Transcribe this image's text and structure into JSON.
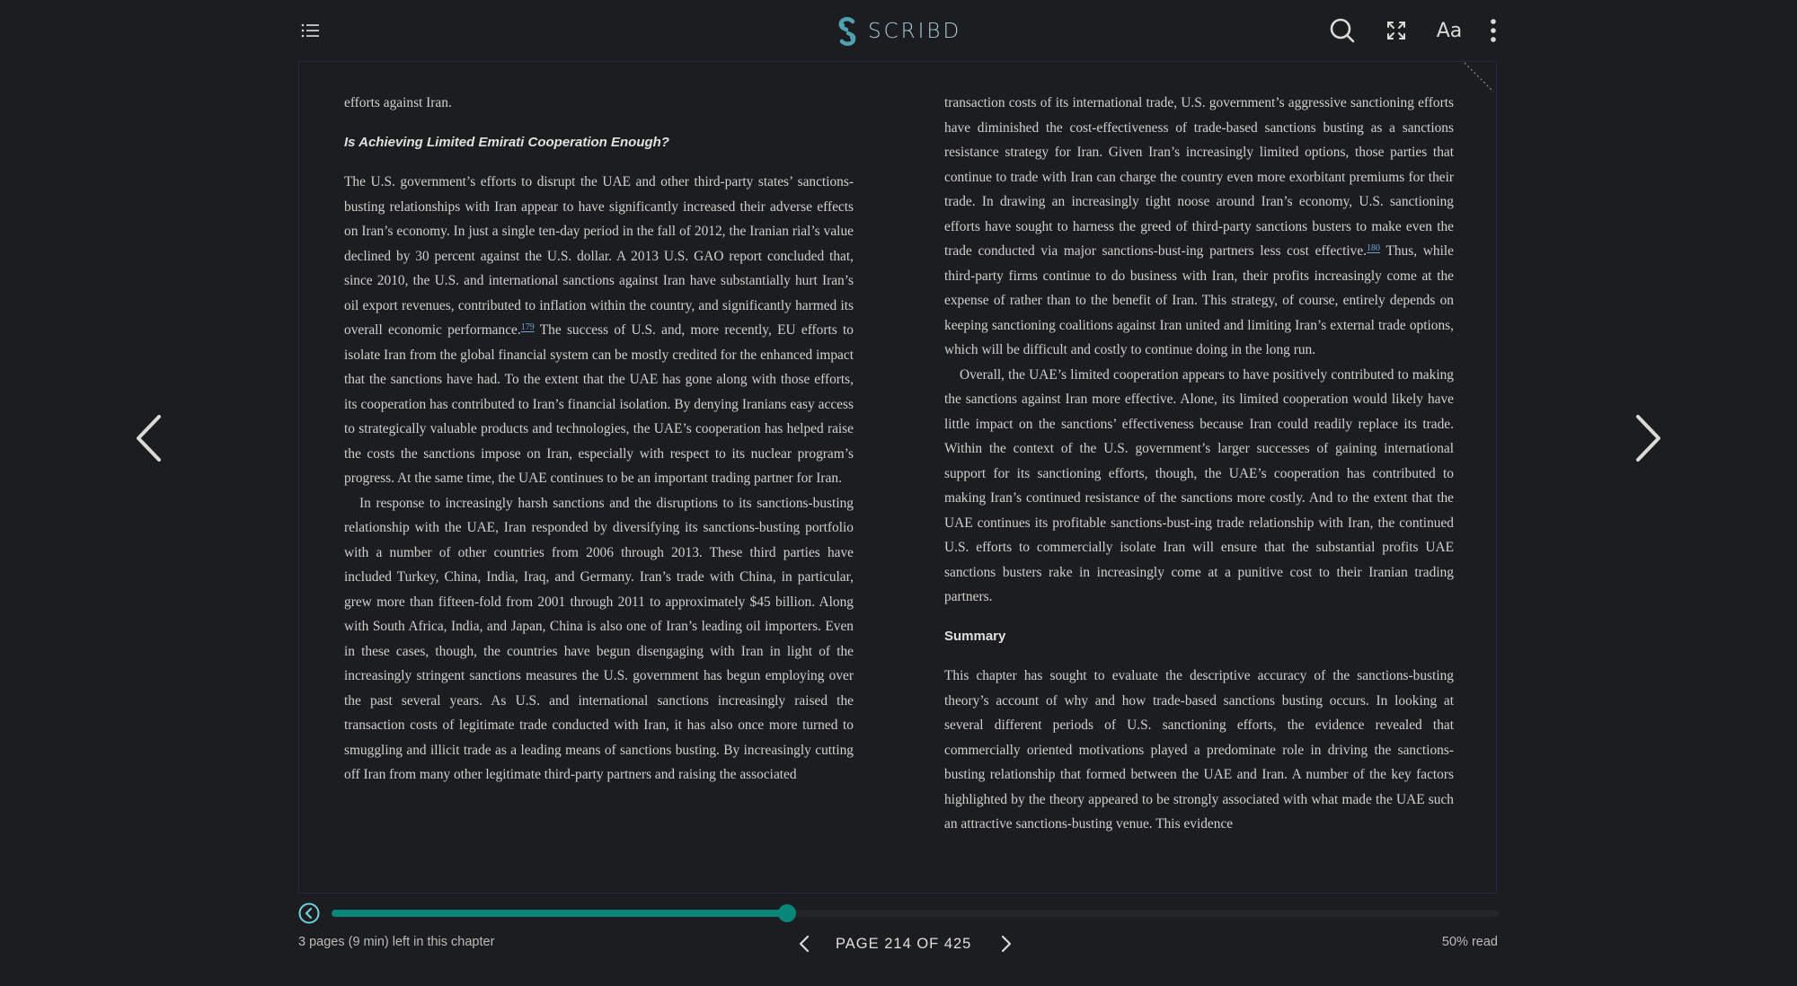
{
  "app": {
    "brand": "SCRIBD",
    "brand_color": "#4fa3b0",
    "accent_color": "#07877a"
  },
  "toolbar": {
    "toc_icon": "list-icon",
    "actions": [
      {
        "name": "search",
        "icon": "search-icon"
      },
      {
        "name": "fullscreen",
        "icon": "fullscreen-icon"
      },
      {
        "name": "font-settings",
        "label": "Aa"
      },
      {
        "name": "more",
        "icon": "more-vertical-icon"
      }
    ]
  },
  "page": {
    "left_column": {
      "p0": "efforts against Iran.",
      "heading": "Is Achieving Limited Emirati Cooperation Enough?",
      "p1_before_fn": "The U.S. government’s efforts to disrupt the UAE and other third-party states’ sanctions-busting relationships with Iran appear to have significantly increased their adverse effects on Iran’s economy. In just a single ten-day period in the fall of 2012, the Iranian rial’s value declined by 30 percent against the U.S. dollar. A 2013 U.S. GAO report concluded that, since 2010, the U.S. and international sanctions against Iran have substantially hurt Iran’s oil export revenues, contributed to infla­tion within the country, and significantly harmed its overall economic performance.",
      "fn1": "179",
      "p1_after_fn": " The success of U.S. and, more recently, EU efforts to isolate Iran from the global financial system can be mostly credited for the enhanced impact that the sanctions have had. To the extent that the UAE has gone along with those efforts, its cooperation has contributed to Iran’s financial isolation. By denying Ira­nians easy access to strategically valuable products and technologies, the UAE’s cooperation has helped raise the costs the sanctions impose on Iran, especially with respect to its nuclear program’s progress. At the same time, the UAE con­tinues to be an important trading partner for Iran.",
      "p2": "In response to increasingly harsh sanctions and the disruptions to its sanctions-busting relationship with the UAE, Iran responded by diversifying its sanctions-busting portfolio with a number of other countries from 2006 through 2013. These third parties have included Turkey, China, India, Iraq, and Germany. Iran’s trade with China, in particular, grew more than fifteen-fold from 2001 through 2011 to ap­proximately $45 billion. Along with South Africa, India, and Japan, China is also one of Iran’s leading oil importers. Even in these cases, though, the countries have begun disengaging with Iran in light of the increasingly stringent sanctions mea­sures the U.S. government has begun employing over the past several years. As U.S. and international sanctions increasingly raised the transaction costs of legit­imate trade conducted with Iran, it has also once more turned to smuggling and il­licit trade as a leading means of sanctions busting. By increasingly cutting off Iran from many other legitimate third-party partners and raising the associated"
    },
    "right_column": {
      "p1_before_fn": "transaction costs of its international trade, U.S. government’s aggressive sanc­tioning efforts have diminished the cost-effectiveness of trade-based sanctions busting as a sanctions resistance strategy for Iran. Given Iran’s increasingly limited options, those parties that continue to trade with Iran can charge the country even more exorbitant premiums for their trade. In drawing an increasingly tight noose around Iran’s economy, U.S. sanctioning efforts have sought to harness the greed of third-party sanctions busters to make even the trade conducted via major sanc­tions-bust-ing partners less cost effective.",
      "fn1": "180",
      "p1_after_fn": " Thus, while third-party firms continue to do business with Iran, their profits increasingly come at the expense of rather than to the benefit of Iran. This strategy, of course, entirely depends on keeping sanctioning coalitions against Iran united and limiting Iran’s external trade options, which will be difficult and costly to continue doing in the long run.",
      "p2": "Overall, the UAE’s limited cooperation appears to have positively contributed to making the sanctions against Iran more effective. Alone, its limited cooperation would likely have little impact on the sanctions’ effectiveness because Iran could readily replace its trade. Within the context of the U.S. government’s larger suc­cesses of gaining international support for its sanctioning efforts, though, the UAE’s cooperation has contributed to making Iran’s continued resistance of the sanctions more costly. And to the extent that the UAE continues its profitable sanc­tions-bust-ing trade relationship with Iran, the continued U.S. efforts to commer­cially isolate Iran will ensure that the substantial profits UAE sanctions busters rake in increasingly come at a punitive cost to their Iranian trading partners.",
      "heading": "Summary",
      "p3": "This chapter has sought to evaluate the descriptive accuracy of the sanctions-busting theory’s account of why and how trade-based sanctions busting occurs. In looking at several different periods of U.S. sanctioning efforts, the evidence re­vealed that commercially oriented motivations played a predominate role in driving the sanctions-busting relationship that formed between the UAE and Iran. A num­ber of the key factors highlighted by the theory appeared to be strongly associated with what made the UAE such an attractive sanctions-busting venue. This evidence"
    }
  },
  "navigation": {
    "prev_icon": "chevron-left-icon",
    "next_icon": "chevron-right-icon"
  },
  "footer": {
    "chapter_remaining": "3 pages (9 min) left in this chapter",
    "page_label": "PAGE 214 OF 425",
    "current_page": 214,
    "total_pages": 425,
    "percent_read_label": "50% read",
    "progress_fraction": 0.39
  }
}
